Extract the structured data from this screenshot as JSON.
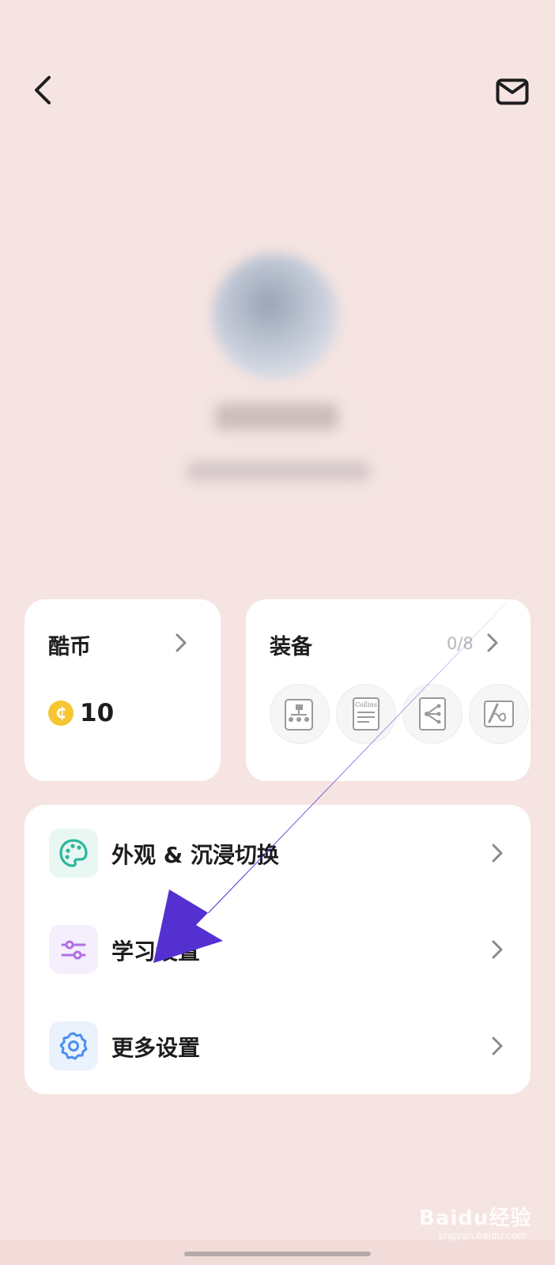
{
  "header": {
    "back_icon": "chevron-left-icon",
    "mail_icon": "mail-icon"
  },
  "coins_card": {
    "title": "酷币",
    "value": "10",
    "coin_symbol": "₵",
    "coin_color": "#f7c531"
  },
  "equipment_card": {
    "title": "装备",
    "count": "0/8",
    "items": [
      "mindmap-icon",
      "collins-dictionary-icon",
      "tree-diagram-icon",
      "pen-infinity-icon"
    ],
    "collins_label": "Collins"
  },
  "settings": {
    "items": [
      {
        "label": "外观 & 沉浸切换",
        "icon": "palette-icon",
        "icon_color": "#2bb89a",
        "icon_bg": "#e8f7f2"
      },
      {
        "label": "学习设置",
        "icon": "sliders-icon",
        "icon_color": "#b06ee8",
        "icon_bg": "#f5eefc"
      },
      {
        "label": "更多设置",
        "icon": "gear-icon",
        "icon_color": "#4a8ff0",
        "icon_bg": "#eaf2fd"
      }
    ]
  },
  "annotation": {
    "arrow_color": "#5530d0"
  },
  "watermark": {
    "text": "Baidu经验",
    "sub": "jingyan.baidu.com"
  }
}
